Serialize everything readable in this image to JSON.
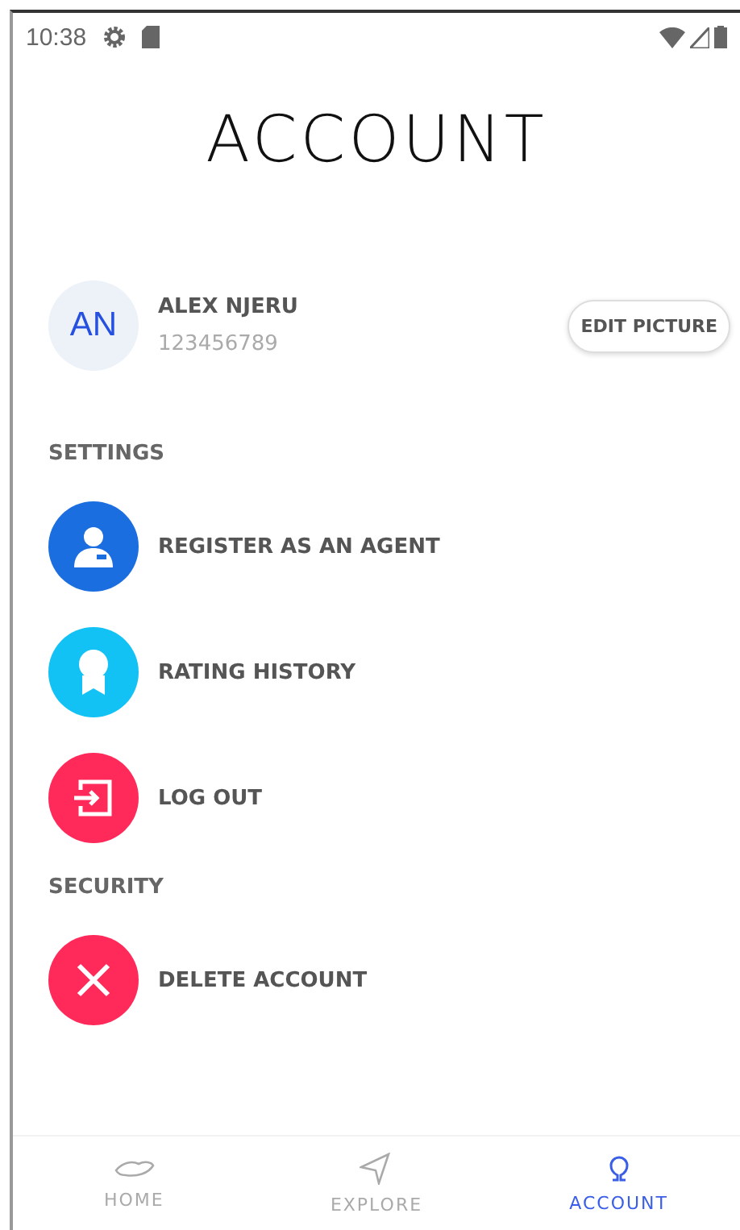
{
  "status_bar": {
    "time": "10:38"
  },
  "title": "ACCOUNT",
  "profile": {
    "initials": "AN",
    "name": "ALEX NJERU",
    "number": "123456789",
    "edit_button": "EDIT PICTURE"
  },
  "sections": [
    {
      "heading": "SETTINGS",
      "items": [
        {
          "label": "REGISTER AS AN AGENT",
          "kind": "agent",
          "color": "#1a6ee0"
        },
        {
          "label": "RATING HISTORY",
          "kind": "rating",
          "color": "#13c2f5"
        },
        {
          "label": "LOG OUT",
          "kind": "logout",
          "color": "#ff2a5a"
        }
      ]
    },
    {
      "heading": "SECURITY",
      "items": [
        {
          "label": "DELETE ACCOUNT",
          "kind": "delete",
          "color": "#ff2a5a"
        }
      ]
    }
  ],
  "nav": [
    {
      "label": "HOME",
      "kind": "home",
      "selected": false
    },
    {
      "label": "EXPLORE",
      "kind": "explore",
      "selected": false
    },
    {
      "label": "ACCOUNT",
      "kind": "account",
      "selected": true
    }
  ]
}
